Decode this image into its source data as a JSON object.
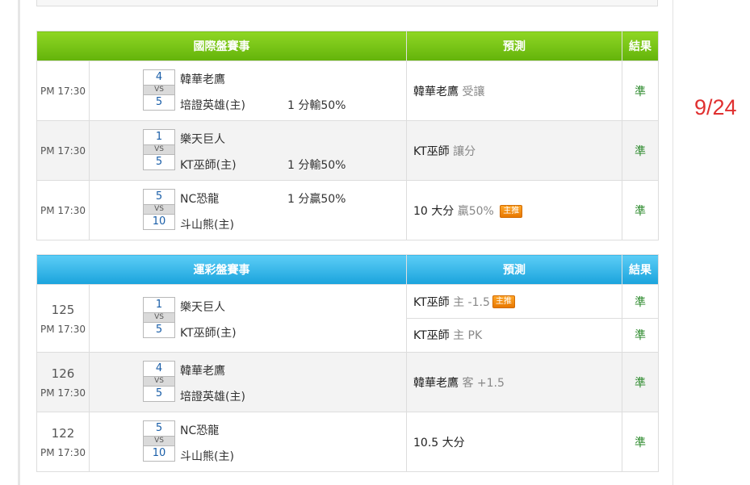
{
  "date_label": "9/24",
  "international": {
    "headers": {
      "game": "國際盤賽事",
      "prediction": "預測",
      "result": "結果"
    },
    "rows": [
      {
        "time": "PM 17:30",
        "away": {
          "score": "4",
          "name": "韓華老鷹"
        },
        "vs": "VS",
        "home": {
          "score": "5",
          "name": "培證英雄(主)"
        },
        "handicap": "1 分輸50%",
        "handicap_row": "home",
        "prediction": {
          "main": "韓華老鷹",
          "sub": "受讓",
          "badge": ""
        },
        "result": "準"
      },
      {
        "time": "PM 17:30",
        "away": {
          "score": "1",
          "name": "樂天巨人"
        },
        "vs": "VS",
        "home": {
          "score": "5",
          "name": "KT巫師(主)"
        },
        "handicap": "1 分輸50%",
        "handicap_row": "home",
        "prediction": {
          "main": "KT巫師",
          "sub": "讓分",
          "badge": ""
        },
        "result": "準"
      },
      {
        "time": "PM 17:30",
        "away": {
          "score": "5",
          "name": "NC恐龍"
        },
        "vs": "VS",
        "home": {
          "score": "10",
          "name": "斗山熊(主)"
        },
        "handicap": "1 分贏50%",
        "handicap_row": "away",
        "prediction": {
          "main": "10 大分",
          "sub": "贏50%",
          "badge": "主推"
        },
        "result": "準"
      }
    ]
  },
  "sports_lottery": {
    "headers": {
      "game": "運彩盤賽事",
      "prediction": "預測",
      "result": "結果"
    },
    "rows": [
      {
        "number": "125",
        "time": "PM 17:30",
        "away": {
          "score": "1",
          "name": "樂天巨人"
        },
        "vs": "VS",
        "home": {
          "score": "5",
          "name": "KT巫師(主)"
        },
        "predictions": [
          {
            "main": "KT巫師",
            "sub": "主 -1.5",
            "badge": "主推",
            "result": "準"
          },
          {
            "main": "KT巫師",
            "sub": "主 PK",
            "badge": "",
            "result": "準"
          }
        ]
      },
      {
        "number": "126",
        "time": "PM 17:30",
        "away": {
          "score": "4",
          "name": "韓華老鷹"
        },
        "vs": "VS",
        "home": {
          "score": "5",
          "name": "培證英雄(主)"
        },
        "prediction": {
          "main": "韓華老鷹",
          "sub": "客 +1.5",
          "badge": ""
        },
        "result": "準"
      },
      {
        "number": "122",
        "time": "PM 17:30",
        "away": {
          "score": "5",
          "name": "NC恐龍"
        },
        "vs": "VS",
        "home": {
          "score": "10",
          "name": "斗山熊(主)"
        },
        "prediction": {
          "main": "10.5 大分",
          "sub": "",
          "badge": ""
        },
        "result": "準"
      }
    ]
  }
}
